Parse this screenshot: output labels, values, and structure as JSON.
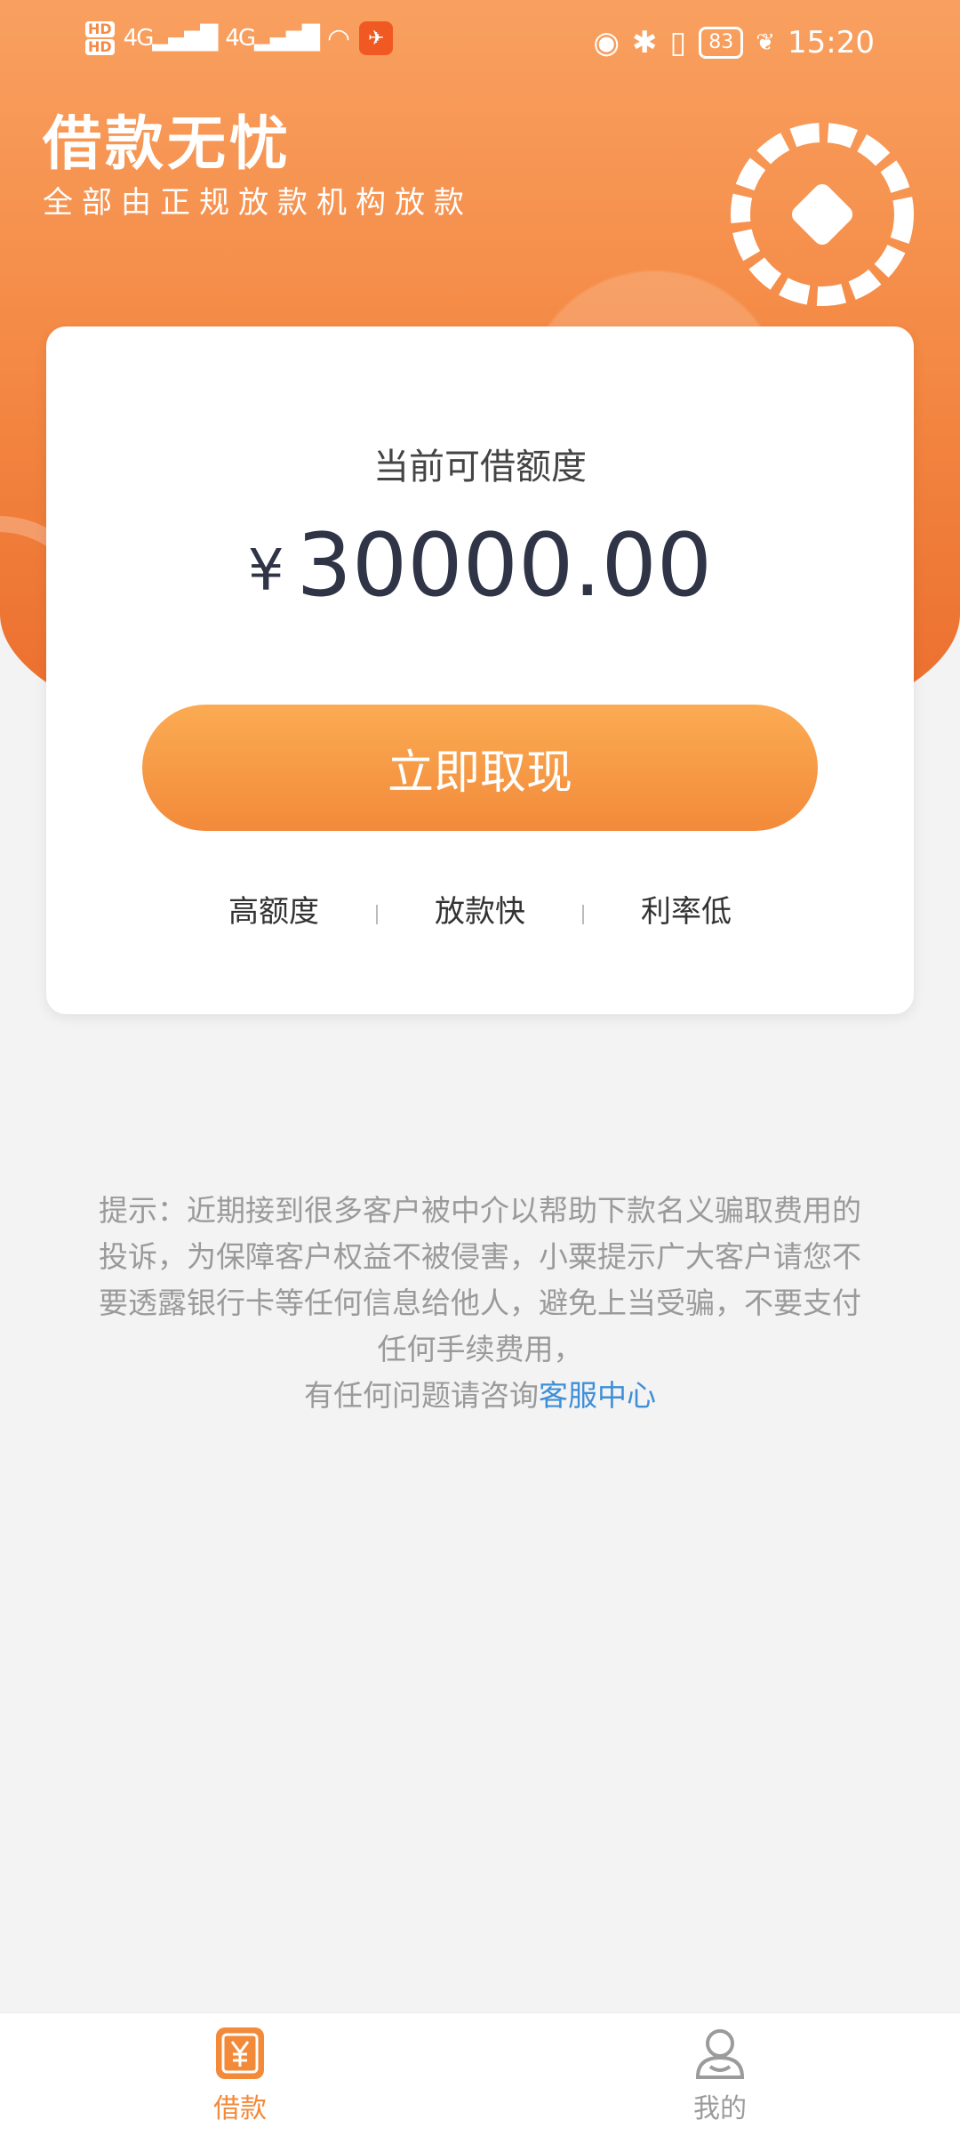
{
  "status_bar": {
    "time": "15:20",
    "battery": "83",
    "sim1": "HD",
    "sim2": "HD",
    "network1": "4G",
    "network2": "4G"
  },
  "header": {
    "title": "借款无忧",
    "subtitle": "全部由正规放款机构放款"
  },
  "card": {
    "credit_label": "当前可借额度",
    "currency_symbol": "¥",
    "credit_amount": "30000.00",
    "withdraw_button": "立即取现",
    "features": [
      "高额度",
      "放款快",
      "利率低"
    ]
  },
  "notice": {
    "text": "提示：近期接到很多客户被中介以帮助下款名义骗取费用的投诉，为保障客户权益不被侵害，小粟提示广大客户请您不要透露银行卡等任何信息给他人，避免上当受骗，不要支付任何手续费用，",
    "contact_prefix": "有任何问题请咨询",
    "contact_link": "客服中心"
  },
  "tabbar": {
    "tabs": [
      {
        "label": "借款",
        "icon": "yuan-icon",
        "active": true
      },
      {
        "label": "我的",
        "icon": "user-icon",
        "active": false
      }
    ]
  },
  "colors": {
    "brand_orange": "#f48a45",
    "link_blue": "#3e8fd8",
    "amount_dark": "#2f3446"
  }
}
